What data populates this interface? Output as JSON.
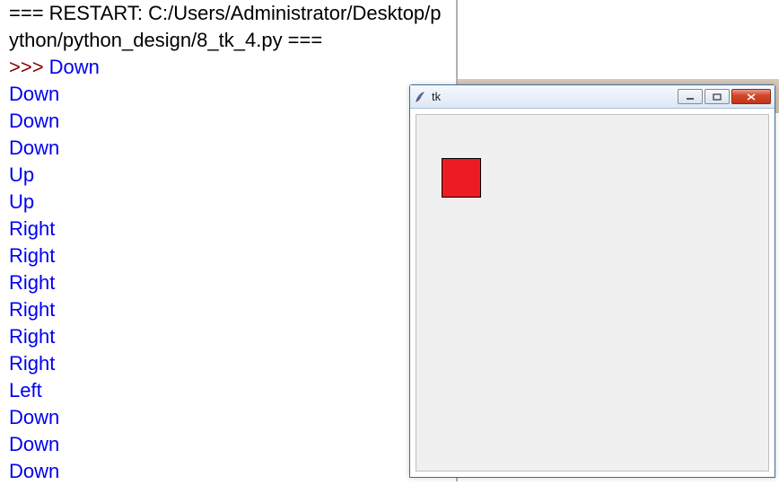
{
  "shell": {
    "restart_line": "=== RESTART: C:/Users/Administrator/Desktop/python/python_design/8_tk_4.py ===",
    "prompt": ">>> ",
    "outputs": [
      "Down",
      "Down",
      "Down",
      "Down",
      "Up",
      "Up",
      "Right",
      "Right",
      "Right",
      "Right",
      "Right",
      "Right",
      "Left",
      "Down",
      "Down",
      "Down"
    ]
  },
  "tk_window": {
    "title": "tk",
    "icon_name": "feather-icon",
    "buttons": {
      "minimize": "minimize",
      "maximize": "maximize",
      "close": "close"
    },
    "square": {
      "color": "#ed1c24"
    }
  }
}
